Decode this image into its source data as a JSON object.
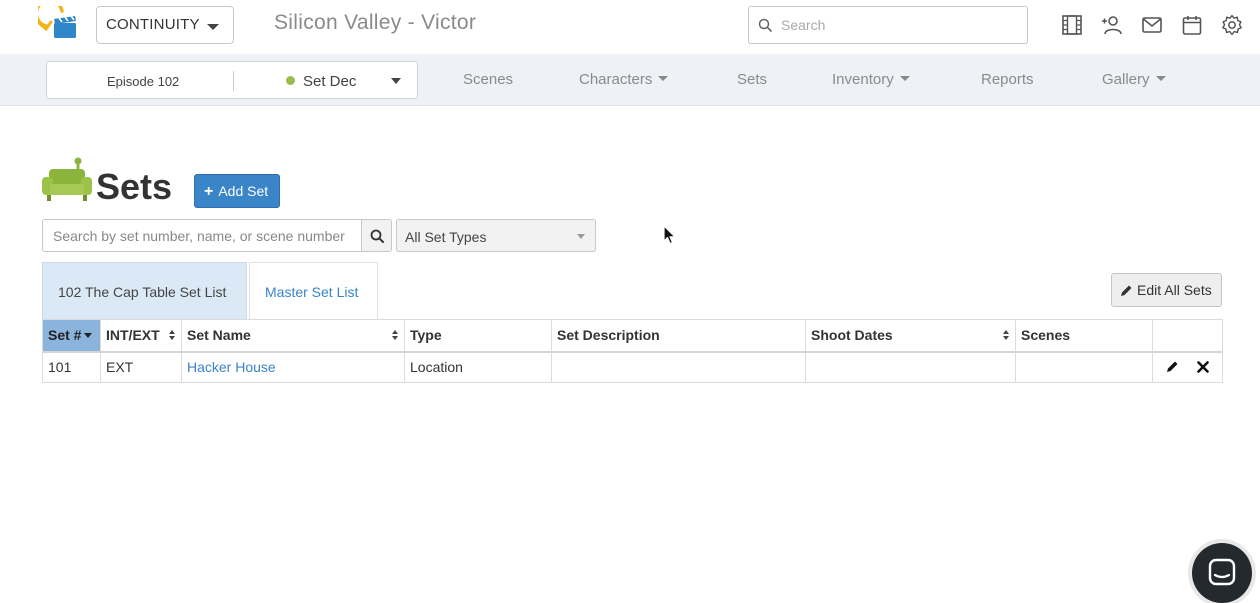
{
  "header": {
    "module": "CONTINUITY",
    "project_title": "Silicon Valley - Victor",
    "search_placeholder": "Search",
    "icons": [
      "film-icon",
      "add-user-icon",
      "mail-icon",
      "calendar-icon",
      "gear-icon"
    ]
  },
  "subnav": {
    "episode": "Episode 102",
    "department": "Set Dec",
    "department_color": "#9bbb4a",
    "items": [
      {
        "label": "Scenes",
        "dropdown": false
      },
      {
        "label": "Characters",
        "dropdown": true
      },
      {
        "label": "Sets",
        "dropdown": false
      },
      {
        "label": "Inventory",
        "dropdown": true
      },
      {
        "label": "Reports",
        "dropdown": false
      },
      {
        "label": "Gallery",
        "dropdown": true
      }
    ]
  },
  "page": {
    "title": "Sets",
    "icon": "sofa-icon",
    "add_button": "Add Set"
  },
  "filters": {
    "search_placeholder": "Search by set number, name, or scene number",
    "set_type": "All Set Types"
  },
  "tabs": [
    {
      "label": "102 The Cap Table Set List",
      "active": true
    },
    {
      "label": "Master Set List",
      "active": false
    }
  ],
  "edit_all_button": "Edit All Sets",
  "table": {
    "columns": [
      "Set #",
      "INT/EXT",
      "Set Name",
      "Type",
      "Set Description",
      "Shoot Dates",
      "Scenes",
      ""
    ],
    "rows": [
      {
        "set_number": "101",
        "int_ext": "EXT",
        "set_name": "Hacker House",
        "type": "Location",
        "description": "",
        "shoot_dates": "",
        "scenes": ""
      }
    ]
  },
  "colors": {
    "accent": "#3a84c8",
    "sorted_header": "#8ab4dc",
    "active_tab": "#dbe9f6",
    "subnav_bg": "#eef2f6",
    "logo_yellow": "#f2b51c",
    "logo_blue": "#2f86c9",
    "sofa_green": "#8bb43c"
  }
}
